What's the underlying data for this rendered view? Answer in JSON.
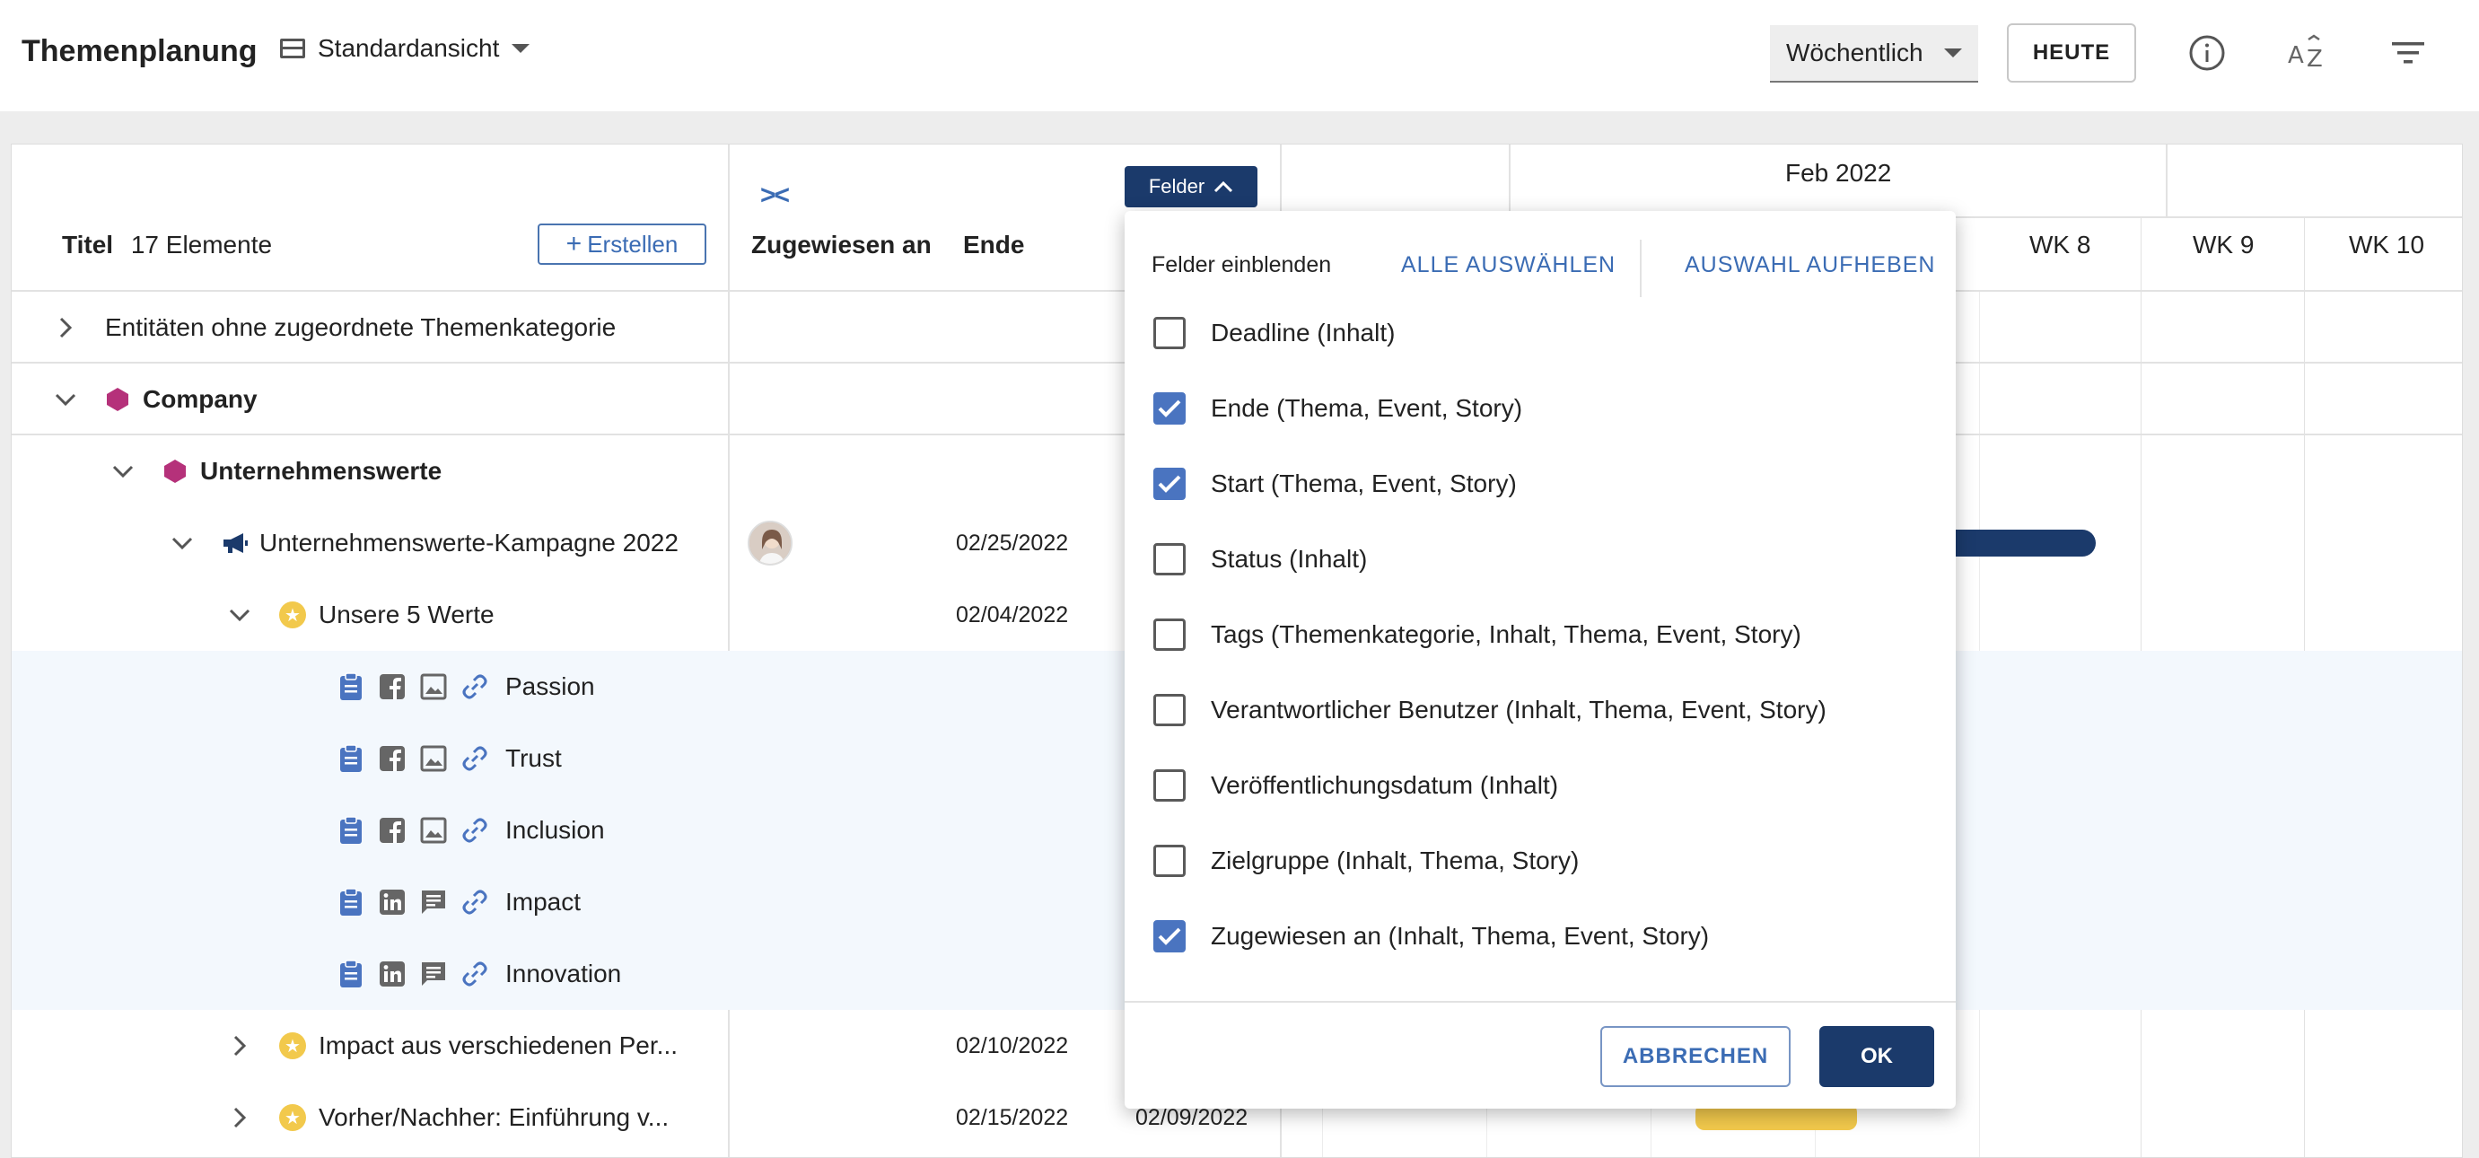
{
  "header": {
    "title": "Themenplanung",
    "view_label": "Standardansicht",
    "period_label": "Wöchentlich",
    "today_label": "HEUTE"
  },
  "list_header": {
    "title_label": "Titel",
    "count_label": "17 Elemente",
    "create_label": "Erstellen",
    "col_assigned": "Zugewiesen an",
    "col_end": "Ende",
    "felder_label": "Felder"
  },
  "timeline": {
    "month": "Feb 2022",
    "weeks": [
      "WK 8",
      "WK 9",
      "WK 10"
    ]
  },
  "rows": [
    {
      "label": "Entitäten ohne zugeordnete Themenkategorie"
    },
    {
      "label": "Company"
    },
    {
      "label": "Unternehmenswerte"
    },
    {
      "label": "Unternehmenswerte-Kampagne 2022",
      "end": "02/25/2022"
    },
    {
      "label": "Unsere 5 Werte",
      "end": "02/04/2022"
    },
    {
      "label": "Passion"
    },
    {
      "label": "Trust"
    },
    {
      "label": "Inclusion"
    },
    {
      "label": "Impact"
    },
    {
      "label": "Innovation"
    },
    {
      "label": "Impact aus verschiedenen Per...",
      "end": "02/10/2022"
    },
    {
      "label": "Vorher/Nachher: Einführung v...",
      "end": "02/15/2022",
      "start": "02/09/2022"
    }
  ],
  "fields_popup": {
    "heading": "Felder einblenden",
    "select_all": "ALLE AUSWÄHLEN",
    "deselect_all": "AUSWAHL AUFHEBEN",
    "options": [
      {
        "label": "Deadline (Inhalt)",
        "checked": false
      },
      {
        "label": "Ende (Thema, Event, Story)",
        "checked": true
      },
      {
        "label": "Start (Thema, Event, Story)",
        "checked": true
      },
      {
        "label": "Status (Inhalt)",
        "checked": false
      },
      {
        "label": "Tags (Themenkategorie, Inhalt, Thema, Event, Story)",
        "checked": false
      },
      {
        "label": "Verantwortlicher Benutzer (Inhalt, Thema, Event, Story)",
        "checked": false
      },
      {
        "label": "Veröffentlichungsdatum (Inhalt)",
        "checked": false
      },
      {
        "label": "Zielgruppe (Inhalt, Thema, Story)",
        "checked": false
      },
      {
        "label": "Zugewiesen an (Inhalt, Thema, Event, Story)",
        "checked": true
      }
    ],
    "cancel_label": "ABBRECHEN",
    "ok_label": "OK"
  },
  "colors": {
    "accent": "#3b6cb4",
    "primary_dark": "#1b3a6b",
    "category": "#b5317a",
    "star": "#f2c94c",
    "highlight_row": "#f3f8fd"
  }
}
